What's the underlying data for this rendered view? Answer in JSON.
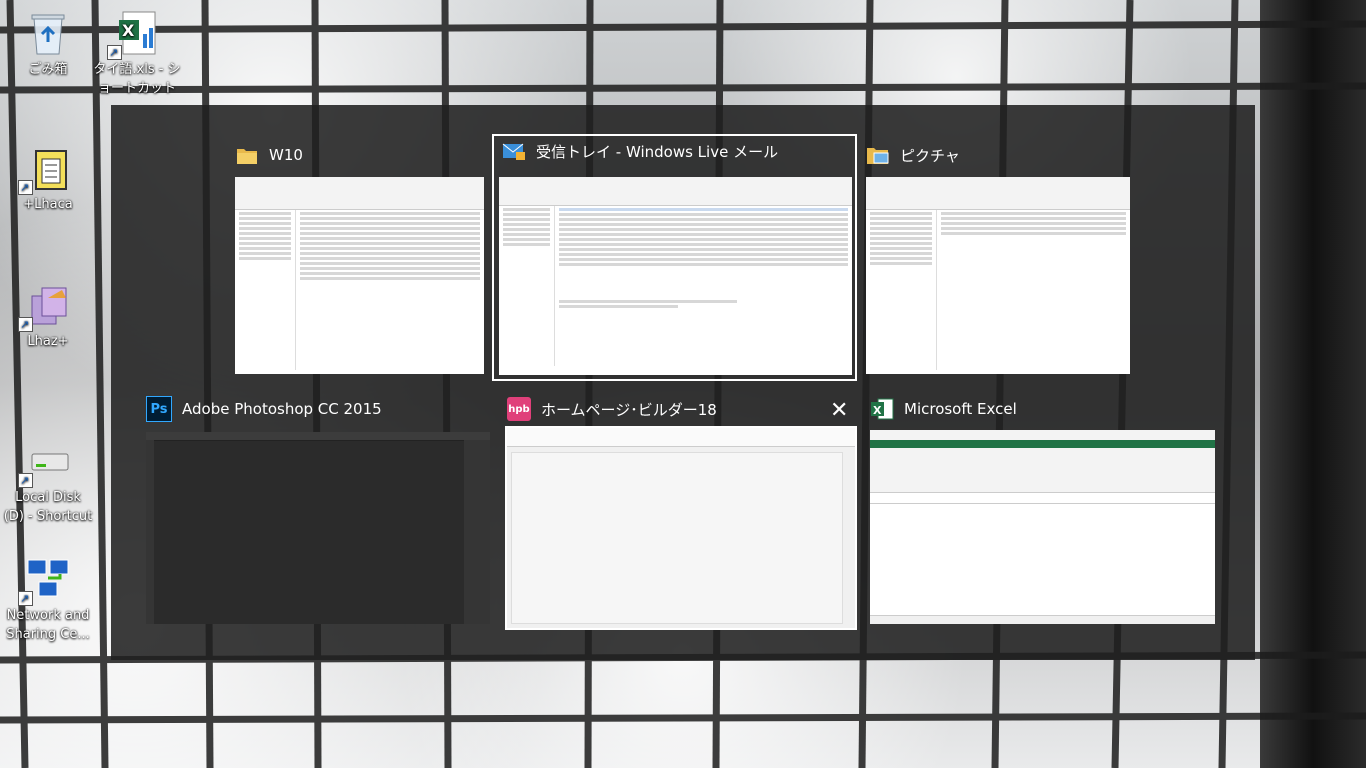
{
  "desktop_icons": [
    {
      "id": "recycle-bin",
      "label": "ごみ箱",
      "icon": "recycle-bin-icon"
    },
    {
      "id": "excel-shortcut",
      "label": "タイ語.xls - ショートカット",
      "icon": "excel-file-icon"
    },
    {
      "id": "lhaca",
      "label": "+Lhaca",
      "icon": "lhaca-icon"
    },
    {
      "id": "lhaz",
      "label": "Lhaz+",
      "icon": "lhaz-icon"
    },
    {
      "id": "local-disk",
      "label": "Local Disk (D) - Shortcut",
      "icon": "disk-drive-icon"
    },
    {
      "id": "network",
      "label": "Network and Sharing Ce...",
      "icon": "network-icon"
    }
  ],
  "windows": [
    {
      "id": "w10",
      "title": "W10",
      "icon": "folder-icon",
      "selected": false
    },
    {
      "id": "mail",
      "title": "受信トレイ - Windows Live メール",
      "icon": "windows-live-mail-icon",
      "selected": true
    },
    {
      "id": "pictures",
      "title": "ピクチャ",
      "icon": "pictures-folder-icon",
      "selected": false
    },
    {
      "id": "photoshop",
      "title": "Adobe Photoshop CC 2015",
      "icon": "photoshop-icon",
      "icon_text": "Ps",
      "selected": false
    },
    {
      "id": "hpb",
      "title": "ホームページ･ビルダー18",
      "icon": "homepage-builder-icon",
      "icon_text": "hpb",
      "selected": false
    },
    {
      "id": "excel",
      "title": "Microsoft Excel",
      "icon": "excel-icon",
      "selected": false
    }
  ],
  "colors": {
    "overlay": "#202020",
    "photoshop_blue": "#31a8ff",
    "hpb_pink": "#e0407a",
    "excel_green": "#217346",
    "folder_yellow": "#e8b94b"
  }
}
